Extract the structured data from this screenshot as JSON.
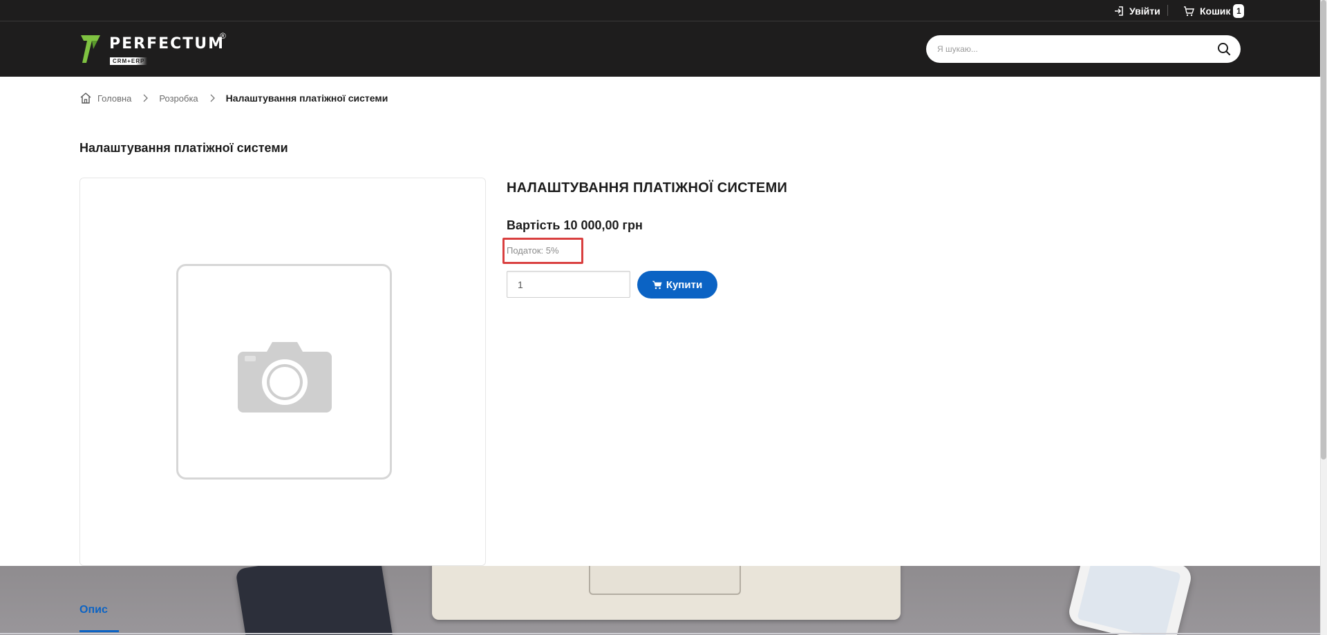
{
  "topbar": {
    "login_label": "Увійти",
    "cart_label": "Кошик",
    "cart_count": "1"
  },
  "header": {
    "logo_text": "PERFECTUM",
    "logo_sub": "CRM+ERP",
    "logo_reg": "®",
    "search_placeholder": "Я шукаю..."
  },
  "breadcrumb": {
    "home": "Головна",
    "section": "Розробка",
    "current": "Налаштування платіжної системи"
  },
  "page_title": "Налаштування платіжної системи",
  "product": {
    "name": "НАЛАШТУВАННЯ ПЛАТІЖНОЇ СИСТЕМИ",
    "price": "Вартість 10 000,00 грн",
    "tax": "Податок: 5%",
    "quantity": "1",
    "buy_label": "Купити"
  },
  "tabs": {
    "description": "Опис"
  },
  "colors": {
    "header_bg": "#1e1d1d",
    "accent": "#0b63c4",
    "highlight": "#d93f3f",
    "logo_green": "#7fc241"
  }
}
